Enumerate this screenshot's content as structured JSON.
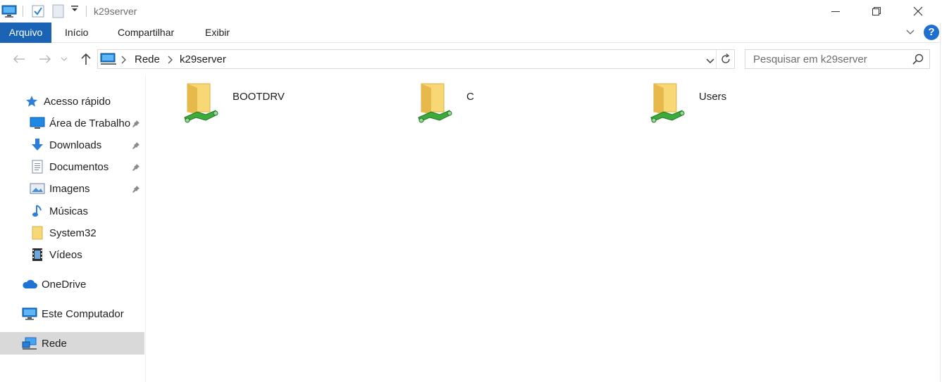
{
  "window": {
    "title": "k29server",
    "controls": {
      "minimize": "—",
      "restore": "❐",
      "close": "✕"
    }
  },
  "ribbon": {
    "tabs": [
      {
        "label": "Arquivo"
      },
      {
        "label": "Início"
      },
      {
        "label": "Compartilhar"
      },
      {
        "label": "Exibir"
      }
    ],
    "help_label": "?"
  },
  "address": {
    "segments": [
      "Rede",
      "k29server"
    ]
  },
  "search": {
    "placeholder": "Pesquisar em k29server"
  },
  "nav": {
    "quick_access": {
      "label": "Acesso rápido",
      "items": [
        {
          "label": "Área de Trabalho",
          "icon": "desktop-icon",
          "pinned": true
        },
        {
          "label": "Downloads",
          "icon": "download-icon",
          "pinned": true
        },
        {
          "label": "Documentos",
          "icon": "document-icon",
          "pinned": true
        },
        {
          "label": "Imagens",
          "icon": "pictures-icon",
          "pinned": true
        },
        {
          "label": "Músicas",
          "icon": "music-icon",
          "pinned": false
        },
        {
          "label": "System32",
          "icon": "folder-icon",
          "pinned": false
        },
        {
          "label": "Vídeos",
          "icon": "video-icon",
          "pinned": false
        }
      ]
    },
    "onedrive": {
      "label": "OneDrive"
    },
    "this_pc": {
      "label": "Este Computador"
    },
    "network": {
      "label": "Rede",
      "selected": true
    }
  },
  "content": {
    "items": [
      {
        "label": "BOOTDRV",
        "icon": "shared-folder-icon"
      },
      {
        "label": "C",
        "icon": "shared-folder-icon"
      },
      {
        "label": "Users",
        "icon": "shared-folder-icon"
      }
    ]
  },
  "colors": {
    "accent": "#1a63b5",
    "selection": "#d9d9d9",
    "folder": "#f8d775"
  }
}
